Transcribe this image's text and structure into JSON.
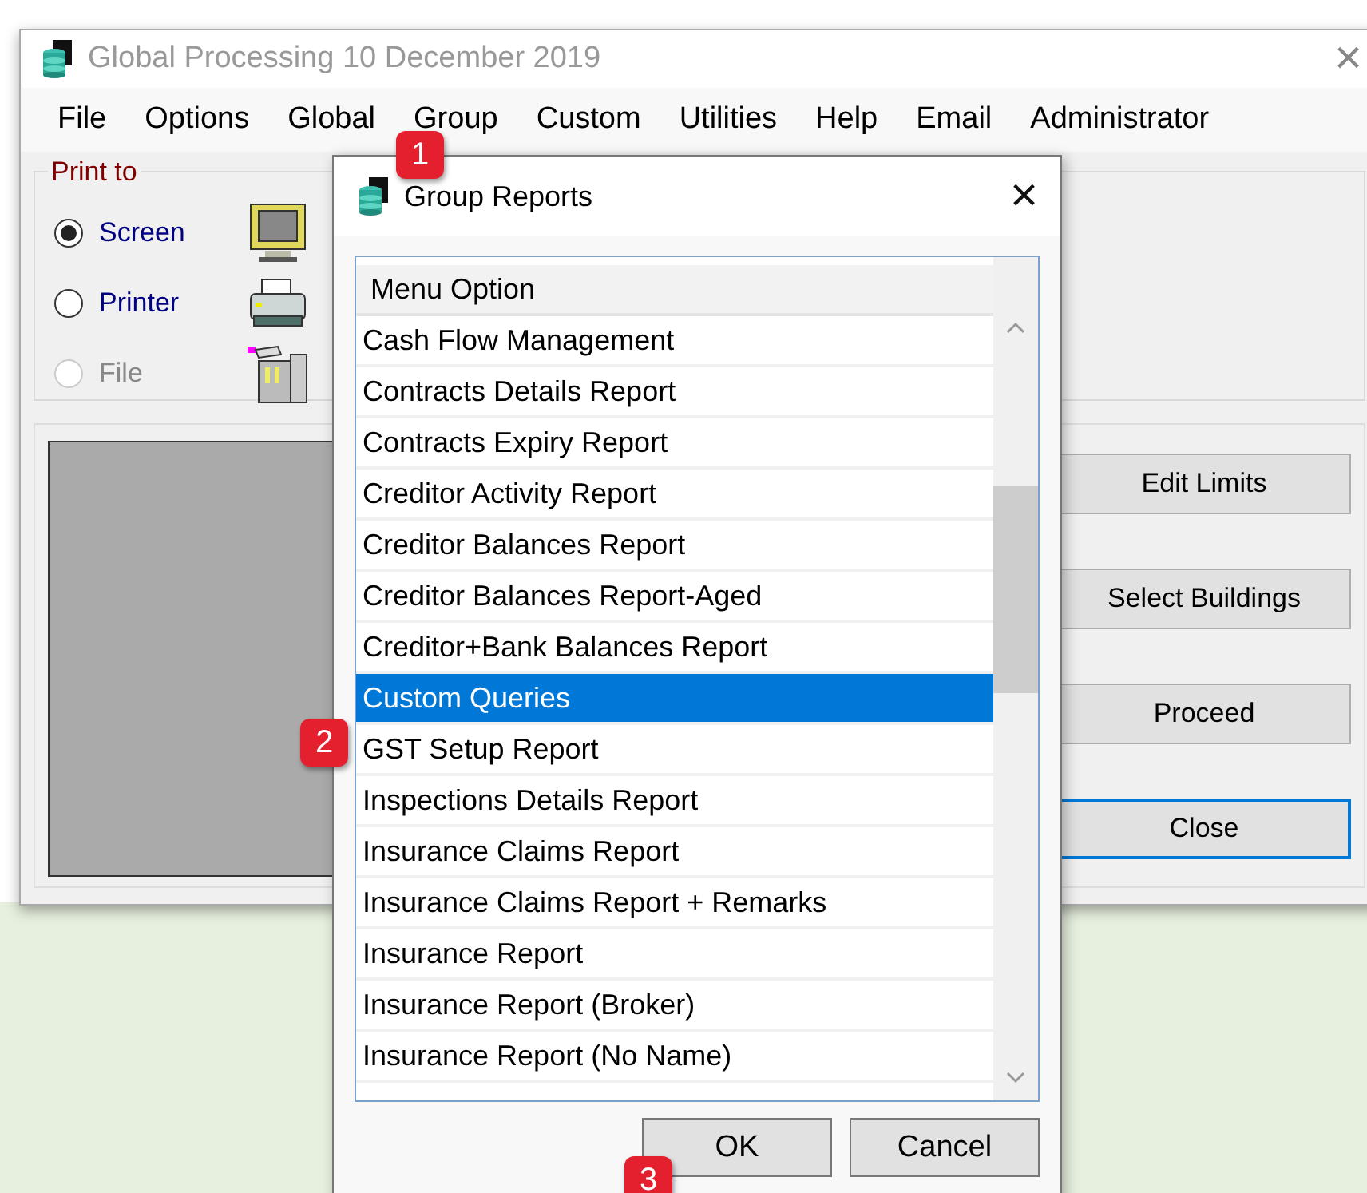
{
  "window": {
    "title": "Global Processing 10 December 2019",
    "close": "×"
  },
  "menu": [
    "File",
    "Options",
    "Global",
    "Group",
    "Custom",
    "Utilities",
    "Help",
    "Email",
    "Administrator"
  ],
  "print_to": {
    "label": "Print to",
    "options": [
      {
        "label": "Screen",
        "checked": true,
        "disabled": false
      },
      {
        "label": "Printer",
        "checked": false,
        "disabled": false
      },
      {
        "label": "File",
        "checked": false,
        "disabled": true
      }
    ]
  },
  "side_buttons": [
    {
      "label": "Edit Limits",
      "focused": false
    },
    {
      "label": "Select Buildings",
      "focused": false
    },
    {
      "label": "Proceed",
      "focused": false
    },
    {
      "label": "Close",
      "focused": true
    }
  ],
  "dialog": {
    "title": "Group Reports",
    "close": "×",
    "column": "Menu Option",
    "items": [
      {
        "label": "Cash Flow Management",
        "selected": false
      },
      {
        "label": "Contracts Details Report",
        "selected": false
      },
      {
        "label": "Contracts Expiry Report",
        "selected": false
      },
      {
        "label": "Creditor Activity Report",
        "selected": false
      },
      {
        "label": "Creditor Balances Report",
        "selected": false
      },
      {
        "label": "Creditor Balances Report-Aged",
        "selected": false
      },
      {
        "label": "Creditor+Bank Balances Report",
        "selected": false
      },
      {
        "label": "Custom Queries",
        "selected": true
      },
      {
        "label": "GST Setup Report",
        "selected": false
      },
      {
        "label": "Inspections Details Report",
        "selected": false
      },
      {
        "label": "Insurance Claims Report",
        "selected": false
      },
      {
        "label": "Insurance Claims Report + Remarks",
        "selected": false
      },
      {
        "label": "Insurance Report",
        "selected": false
      },
      {
        "label": "Insurance Report (Broker)",
        "selected": false
      },
      {
        "label": "Insurance Report (No Name)",
        "selected": false
      }
    ],
    "buttons": [
      "OK",
      "Cancel"
    ]
  },
  "callouts": [
    "1",
    "2",
    "3"
  ]
}
